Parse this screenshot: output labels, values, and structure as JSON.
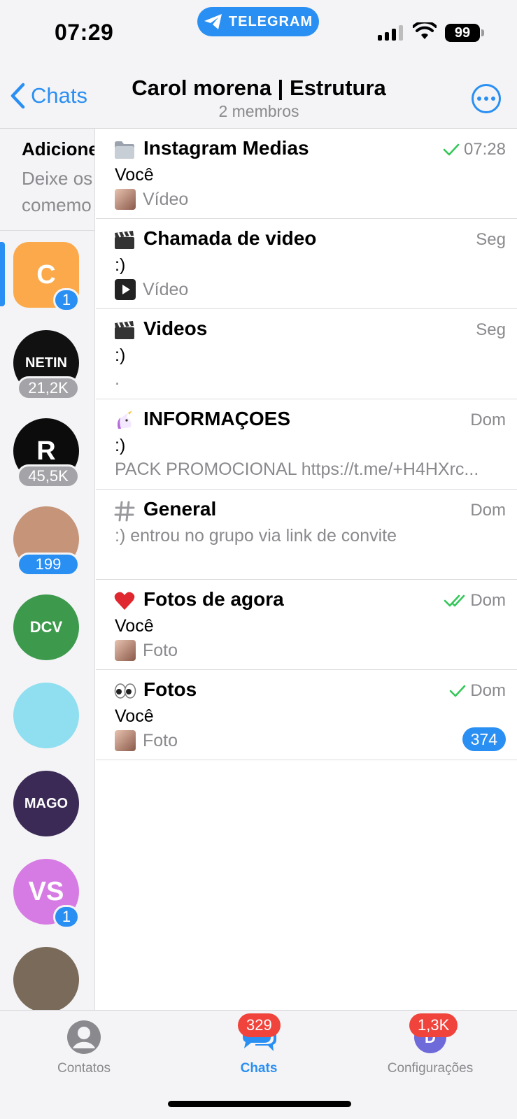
{
  "status_bar": {
    "time": "07:29",
    "app_pill": "TELEGRAM",
    "battery": "99"
  },
  "header": {
    "back_label": "Chats",
    "title": "Carol morena | Estrutura",
    "subtitle": "2 membros",
    "more_icon": "more-circle-icon"
  },
  "sidebar": {
    "promo_title": "Adicione",
    "promo_text_line1": "Deixe os",
    "promo_text_line2": "comemo",
    "avatars": [
      {
        "label": "C",
        "badge": "1",
        "badge_style": "blue",
        "color": "#fba94b"
      },
      {
        "label": "NETIN",
        "badge": "21,2K",
        "badge_style": "grey",
        "color": "#111111"
      },
      {
        "label": "R",
        "badge": "45,5K",
        "badge_style": "grey",
        "color": "#0c0c0c"
      },
      {
        "label": "",
        "badge": "199",
        "badge_style": "blue",
        "color": "#c69478"
      },
      {
        "label": "DCV",
        "badge": "",
        "badge_style": "",
        "color": "#3d9a4d"
      },
      {
        "label": "",
        "badge": "",
        "badge_style": "",
        "color": "#8fdff0"
      },
      {
        "label": "MAGO",
        "badge": "",
        "badge_style": "",
        "color": "#3a2a55"
      },
      {
        "label": "VS",
        "badge": "1",
        "badge_style": "blue",
        "color": "#d77be4"
      },
      {
        "label": "",
        "badge": "",
        "badge_style": "",
        "color": "#7a6a5a"
      }
    ]
  },
  "topics": [
    {
      "icon": "folder-icon",
      "name": "Instagram Medias",
      "time": "07:28",
      "check": "single",
      "sender": "Você",
      "preview": "Vídeo",
      "thumb": "photo",
      "count": ""
    },
    {
      "icon": "clapper-icon",
      "name": "Chamada de video",
      "time": "Seg",
      "check": "",
      "sender": ":)",
      "preview": "Vídeo",
      "thumb": "video",
      "count": ""
    },
    {
      "icon": "clapper-icon",
      "name": "Videos",
      "time": "Seg",
      "check": "",
      "sender": ":)",
      "preview": ".",
      "thumb": "",
      "count": ""
    },
    {
      "icon": "unicorn-icon",
      "name": "INFORMAÇOES",
      "time": "Dom",
      "check": "",
      "sender": ":)",
      "preview": "PACK PROMOCIONAL https://t.me/+H4HXrc...",
      "thumb": "",
      "count": ""
    },
    {
      "icon": "hash-icon",
      "name": "General",
      "time": "Dom",
      "check": "",
      "sender": ":) entrou no grupo via link de convite",
      "preview": "",
      "thumb": "",
      "count": ""
    },
    {
      "icon": "heart-icon",
      "name": "Fotos de agora",
      "time": "Dom",
      "check": "double",
      "sender": "Você",
      "preview": "Foto",
      "thumb": "photo",
      "count": ""
    },
    {
      "icon": "eyes-icon",
      "name": "Fotos",
      "time": "Dom",
      "check": "single",
      "sender": "Você",
      "preview": "Foto",
      "thumb": "photo",
      "count": "374"
    }
  ],
  "tabbar": {
    "contacts_label": "Contatos",
    "chats_label": "Chats",
    "chats_badge": "329",
    "settings_label": "Configurações",
    "settings_badge": "1,3K"
  },
  "colors": {
    "accent": "#2a8ff2",
    "check_green": "#34c759",
    "badge_red": "#f0433b"
  }
}
